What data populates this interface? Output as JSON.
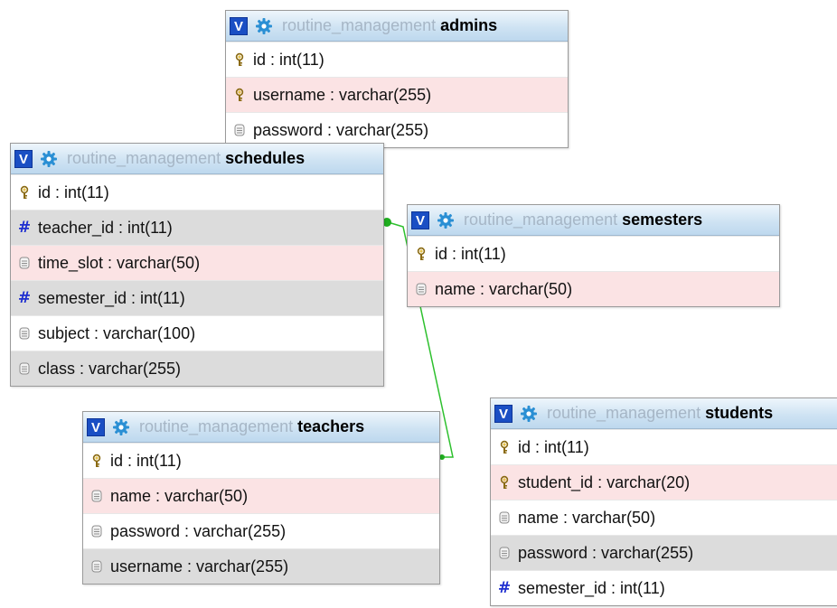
{
  "colors": {
    "header_top": "#eef6fc",
    "header_bottom": "#bdd8ee",
    "toggle_bg": "#1a4fc4",
    "db_name_text": "#a6b6c6",
    "row_pink": "#fbe3e4",
    "row_gray": "#dcdcdc",
    "relation_line": "#2ec02e",
    "hash_icon": "#1f2fd0"
  },
  "tables": [
    {
      "id": "admins",
      "toggle": "V",
      "db": "routine_management",
      "name": "admins",
      "columns": [
        {
          "text": "id : int(11)",
          "icon": "key-icon",
          "bg": "white"
        },
        {
          "text": "username : varchar(255)",
          "icon": "key-icon",
          "bg": "pink"
        },
        {
          "text": "password : varchar(255)",
          "icon": "column-icon",
          "bg": "white"
        }
      ]
    },
    {
      "id": "schedules",
      "toggle": "V",
      "db": "routine_management",
      "name": "schedules",
      "columns": [
        {
          "text": "id : int(11)",
          "icon": "key-icon",
          "bg": "white"
        },
        {
          "text": "teacher_id : int(11)",
          "icon": "hash-icon",
          "bg": "gray"
        },
        {
          "text": "time_slot : varchar(50)",
          "icon": "column-icon",
          "bg": "pink"
        },
        {
          "text": "semester_id : int(11)",
          "icon": "hash-icon",
          "bg": "gray"
        },
        {
          "text": "subject : varchar(100)",
          "icon": "column-icon",
          "bg": "white"
        },
        {
          "text": "class : varchar(255)",
          "icon": "column-icon",
          "bg": "gray"
        }
      ]
    },
    {
      "id": "semesters",
      "toggle": "V",
      "db": "routine_management",
      "name": "semesters",
      "columns": [
        {
          "text": "id : int(11)",
          "icon": "key-icon",
          "bg": "white"
        },
        {
          "text": "name : varchar(50)",
          "icon": "column-icon",
          "bg": "pink"
        }
      ]
    },
    {
      "id": "teachers",
      "toggle": "V",
      "db": "routine_management",
      "name": "teachers",
      "columns": [
        {
          "text": "id : int(11)",
          "icon": "key-icon",
          "bg": "white"
        },
        {
          "text": "name : varchar(50)",
          "icon": "column-icon",
          "bg": "pink"
        },
        {
          "text": "password : varchar(255)",
          "icon": "column-icon",
          "bg": "white"
        },
        {
          "text": "username : varchar(255)",
          "icon": "column-icon",
          "bg": "gray"
        }
      ]
    },
    {
      "id": "students",
      "toggle": "V",
      "db": "routine_management",
      "name": "students",
      "columns": [
        {
          "text": "id : int(11)",
          "icon": "key-icon",
          "bg": "white"
        },
        {
          "text": "student_id : varchar(20)",
          "icon": "key-icon",
          "bg": "pink"
        },
        {
          "text": "name : varchar(50)",
          "icon": "column-icon",
          "bg": "white"
        },
        {
          "text": "password : varchar(255)",
          "icon": "column-icon",
          "bg": "gray"
        },
        {
          "text": "semester_id : int(11)",
          "icon": "hash-icon",
          "bg": "white"
        }
      ]
    }
  ]
}
